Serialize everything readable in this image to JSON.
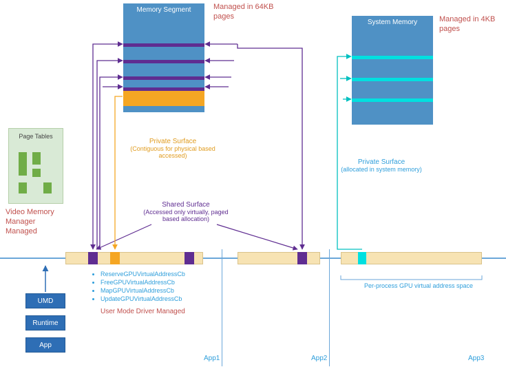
{
  "memory_segment": {
    "title": "Memory Segment",
    "page_note": "Managed in 64KB pages"
  },
  "system_memory": {
    "title": "System Memory",
    "page_note": "Managed in 4KB pages"
  },
  "page_tables": {
    "title": "Page Tables",
    "caption": "Video Memory Manager Managed"
  },
  "private_surface_left": {
    "title": "Private Surface",
    "sub": "(Contiguous for physical based accessed)"
  },
  "shared_surface": {
    "title": "Shared Surface",
    "sub": "(Accessed only virtually, paged based allocation)"
  },
  "private_surface_right": {
    "title": "Private Surface",
    "sub": "(allocated in system memory)"
  },
  "api_list": {
    "items": [
      "ReserveGPUVirtualAddressCb",
      "FreeGPUVirtualAddressCb",
      "MapGPUVirtualAddressCb",
      "UpdateGPUVirtualAddressCb"
    ],
    "caption": "User Mode Driver Managed"
  },
  "stack": {
    "umd": "UMD",
    "runtime": "Runtime",
    "app": "App"
  },
  "per_process_label": "Per-process GPU virtual address space",
  "apps": {
    "a1": "App1",
    "a2": "App2",
    "a3": "App3"
  },
  "colors": {
    "purple": "#5f2d91",
    "cyan": "#00e0e0",
    "orange": "#f5a623",
    "blue": "#4f91c5",
    "rail": "#6aa6d9"
  }
}
